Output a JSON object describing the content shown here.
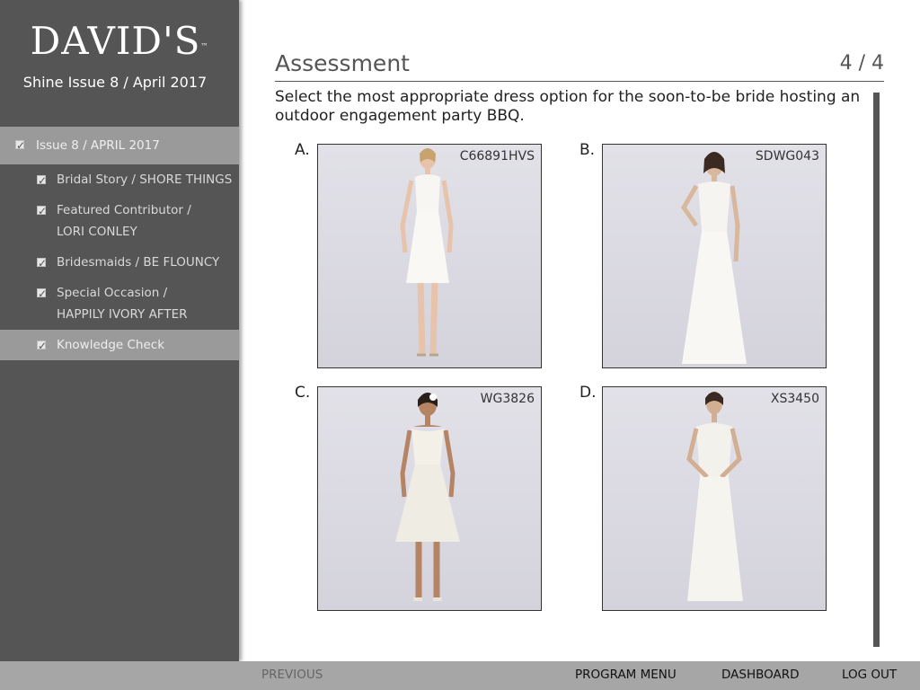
{
  "sidebar": {
    "logo": "DAVID'S",
    "logo_mark": "™",
    "subtitle": "Shine Issue 8 / April 2017",
    "issue": "Issue 8 / APRIL 2017",
    "items": [
      {
        "line1": "Bridal Story / SHORE THINGS",
        "line2": ""
      },
      {
        "line1": "Featured Contributor /",
        "line2": "LORI CONLEY"
      },
      {
        "line1": "Bridesmaids / BE FLOUNCY",
        "line2": ""
      },
      {
        "line1": "Special Occasion /",
        "line2": "HAPPILY IVORY AFTER"
      },
      {
        "line1": "Knowledge Check",
        "line2": ""
      }
    ]
  },
  "main": {
    "title": "Assessment",
    "counter": "4 / 4",
    "question": "Select the most appropriate dress option for the soon-to-be bride hosting an outdoor engagement party BBQ.",
    "options": [
      {
        "letter": "A.",
        "code": "C66891HVS"
      },
      {
        "letter": "B.",
        "code": "SDWG043"
      },
      {
        "letter": "C.",
        "code": "WG3826"
      },
      {
        "letter": "D.",
        "code": "XS3450"
      }
    ]
  },
  "footer": {
    "previous": "PREVIOUS",
    "program_menu": "PROGRAM MENU",
    "dashboard": "DASHBOARD",
    "logout": "LOG OUT"
  }
}
